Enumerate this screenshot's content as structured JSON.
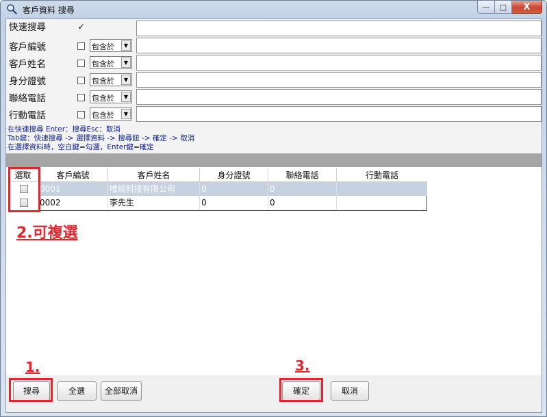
{
  "window": {
    "title": "客戶資料 搜尋",
    "minimize": "—",
    "maximize": "□",
    "close": "X"
  },
  "search": {
    "quick_label": "快速搜尋",
    "quick_checked": "✓",
    "rows": [
      {
        "label": "客戶編號",
        "op": "包含於"
      },
      {
        "label": "客戶姓名",
        "op": "包含於"
      },
      {
        "label": "身分證號",
        "op": "包含於"
      },
      {
        "label": "聯絡電話",
        "op": "包含於"
      },
      {
        "label": "行動電話",
        "op": "包含於"
      }
    ],
    "combo_arrow": "▼",
    "hints": [
      "在快速搜尋 Enter：搜尋Esc：取消",
      "Tab鍵：快速搜尋 -> 選擇資料 -> 搜尋鈕 -> 確定 -> 取消",
      "在選擇資料時，空白鍵=勾選，Enter鍵=確定"
    ]
  },
  "grid": {
    "columns": [
      "選取",
      "客戶編號",
      "客戶姓名",
      "身分證號",
      "聯絡電話",
      "行動電話"
    ],
    "rows": [
      {
        "id": "0001",
        "name": "唯統科技有限公司",
        "idno": "0",
        "phone": "0",
        "mobile": ""
      },
      {
        "id": "0002",
        "name": "李先生",
        "idno": "0",
        "phone": "0",
        "mobile": ""
      }
    ]
  },
  "annotations": {
    "multi": "2.可複選",
    "step1": "1.",
    "step3": "3."
  },
  "buttons": {
    "search": "搜尋",
    "select_all": "全選",
    "cancel_all": "全部取消",
    "ok": "確定",
    "cancel": "取消"
  }
}
